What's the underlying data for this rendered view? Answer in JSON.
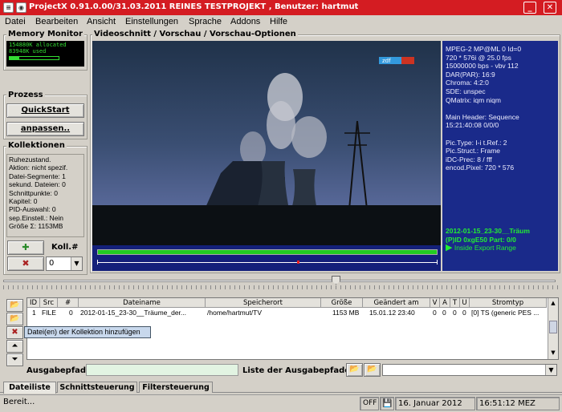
{
  "window": {
    "title": "ProjectX 0.91.0.00/31.03.2011 REINES TESTPROJEKT , Benutzer: hartmut",
    "minimize": "_",
    "close": "✕"
  },
  "menu": [
    "Datei",
    "Bearbeiten",
    "Ansicht",
    "Einstellungen",
    "Sprache",
    "Addons",
    "Hilfe"
  ],
  "memory": {
    "label": "Memory Monitor",
    "allocated": "154880K allocated",
    "used": "83948K used"
  },
  "prozess": {
    "label": "Prozess",
    "quickstart": "QuickStart",
    "anpassen": "anpassen.."
  },
  "kollektionen": {
    "label": "Kollektionen",
    "lines": [
      "Ruhezustand.",
      "Aktion: nicht spezif.",
      "Datei-Segmente: 1",
      "sekund. Dateien: 0",
      "Schnittpunkte: 0",
      "Kapitel: 0",
      "PID-Auswahl: 0",
      "sep.Einstell.: Nein",
      "Größe Σ: 1153MB"
    ],
    "koll_label": "Koll.#",
    "koll_value": "0"
  },
  "video": {
    "label": "Videoschnitt / Vorschau / Vorschau-Optionen",
    "logo": "zdf"
  },
  "info": {
    "lines": [
      "MPEG-2  MP@ML 0 Id=0",
      "720 * 576i @ 25.0 fps",
      "15000000 bps - vbv 112",
      "DAR(PAR):  16:9",
      "Chroma:  4:2:0",
      "SDE: unspec",
      "QMatrix: iqm niqm",
      "",
      "Main Header: Sequence",
      "15:21:40:08   0/0/0",
      "",
      "Pic.Type:  I-i  t.Ref.: 2",
      "Pic.Struct.: Frame",
      "iDC-Prec: 8 / fff",
      "encod.Pixel: 720 * 576"
    ],
    "filename": "2012-01-15_23-30__Träum",
    "pid": "(P)ID 0xgE50   Part: 0/0",
    "export": "Inside Export Range"
  },
  "table": {
    "headers": [
      "ID",
      "Src",
      "#",
      "Dateiname",
      "Speicherort",
      "Größe",
      "Geändert am",
      "V",
      "A",
      "T",
      "U",
      "Stromtyp"
    ],
    "rows": [
      [
        "1",
        "FILE",
        "0",
        "2012-01-15_23-30__Träume_der...",
        "/home/hartmut/TV",
        "1153 MB",
        "15.01.12  23:40",
        "0",
        "0",
        "0",
        "0",
        "[0] TS (generic PES ..."
      ]
    ]
  },
  "tooltip": "Datei(en) der Kollektion hinzufügen",
  "ausgabe": {
    "label": "Ausgabepfad:",
    "value": "",
    "liste_label": "Liste der Ausgabepfade:"
  },
  "tabs": [
    "Dateiliste",
    "Schnittsteuerung",
    "Filtersteuerung"
  ],
  "status": {
    "text": "Bereit...",
    "off": "OFF",
    "date": "16. Januar 2012",
    "time": "16:51:12 MEZ"
  },
  "colors": {
    "title_bar": "#d41c22",
    "info_bg": "#1a2a8a",
    "progress_green": "#22cc22"
  }
}
